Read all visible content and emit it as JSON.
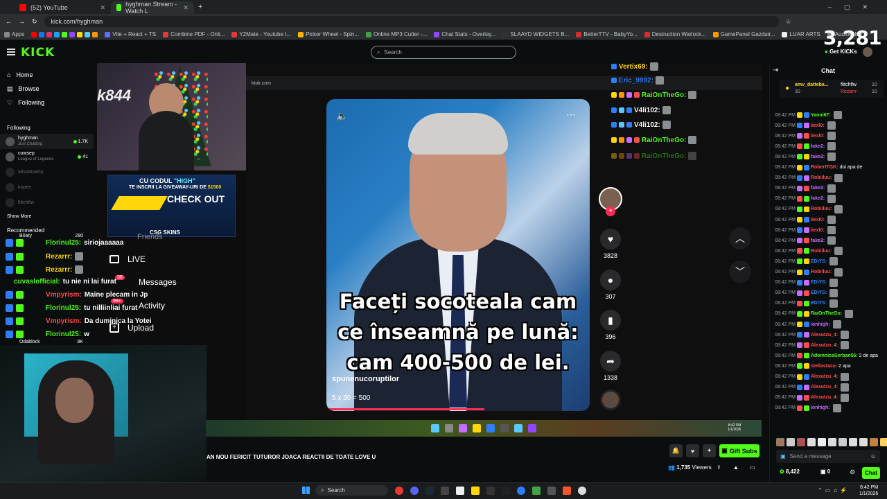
{
  "browser": {
    "tabs": [
      {
        "label": "(52) YouTube",
        "active": false,
        "color": "#ff0000"
      },
      {
        "label": "hyghman Stream - Watch L",
        "active": true,
        "color": "#53fc18"
      }
    ],
    "address": "kick.com/hyghman",
    "bookmarks": [
      "Apps",
      "Vite + React + TS",
      "Combine PDF - Onli...",
      "Y2Mate - Youtube t...",
      "Picker Wheel - Spin...",
      "Online MP3 Cutter -...",
      "Chat Stats - Overlay...",
      "SLAAYD WIDGETS B...",
      "BetterTTV - BabyYo...",
      "Destruction Warlock...",
      "GamePanel Gazduir...",
      "LUAR ARTS",
      "Audiocalter"
    ]
  },
  "kick": {
    "logo": "KICK",
    "search_placeholder": "Search",
    "kick_count": "3,281",
    "get_kicks": "Get KICKs",
    "accent": "#53fc18"
  },
  "sidebar": {
    "nav": [
      {
        "label": "Home",
        "icon": "home-icon"
      },
      {
        "label": "Browse",
        "icon": "browse-icon"
      },
      {
        "label": "Following",
        "icon": "heart-icon"
      }
    ],
    "following_title": "Following",
    "following": [
      {
        "name": "hyghman",
        "category": "Just Chatting",
        "viewers": "1.7K"
      },
      {
        "name": "cowsep",
        "category": "League of Legends",
        "viewers": "41"
      },
      {
        "name": "MissMoarta",
        "category": "",
        "viewers": ""
      },
      {
        "name": "kopee",
        "category": "",
        "viewers": ""
      },
      {
        "name": "flitchflw",
        "category": "",
        "viewers": ""
      }
    ],
    "show_more": "Show More",
    "recommended_title": "Recommended",
    "recommended_top": {
      "name": "B0aty",
      "viewers": "280"
    },
    "recommended_bottom": {
      "name": "Odablock",
      "viewers": "8K"
    }
  },
  "stream_overlay": {
    "webcam_text": "k844",
    "promo": {
      "line1_pre": "CU CODUL ",
      "line1_code": "\"HIGH\"",
      "line2_pre": "TE INSCRII LA GIVEAWAY-URI DE ",
      "line2_amount": "$1500",
      "line3": "CHECK OUT",
      "line4": "CSG SKINS"
    },
    "inner_url": "ktok.com",
    "video": {
      "caption": "Faceți socoteala cam ce înseamnă pe lună: cam 400-500 de lei.",
      "handle": "spunenucoruptilor",
      "calc": "5 x 30 = 500",
      "progress": 0.6
    },
    "actions": [
      {
        "icon": "heart-icon",
        "count": "3828"
      },
      {
        "icon": "comment-icon",
        "count": "307"
      },
      {
        "icon": "bookmark-icon",
        "count": "396"
      },
      {
        "icon": "share-icon",
        "count": "1338"
      }
    ],
    "tiktok_side": [
      {
        "label": "Friends",
        "icon": "friends-icon"
      },
      {
        "label": "LIVE",
        "icon": "live-icon"
      },
      {
        "label": "Messages",
        "icon": "messages-icon"
      },
      {
        "label": "Activity",
        "icon": "activity-icon"
      },
      {
        "label": "Upload",
        "icon": "upload-icon"
      }
    ],
    "badges": {
      "messages": "38",
      "activity": "99+"
    },
    "overlay_chat_left": [
      {
        "user": "Florinul25:",
        "msg": "siriojaaaaaa",
        "color": "#53fc18"
      },
      {
        "user": "Rezarrr:",
        "msg": "",
        "color": "#ffd60a"
      },
      {
        "user": "Rezarrr:",
        "msg": "",
        "color": "#ffd60a"
      },
      {
        "user": "cuvaslofficial:",
        "msg": "tu nie ni lai furat",
        "color": "#53fc18"
      },
      {
        "user": "Vmpyrism:",
        "msg": "Maine plecam in Jp",
        "color": "#ff4d4d"
      },
      {
        "user": "Florinul25:",
        "msg": "tu nilliinliai furat",
        "color": "#53fc18"
      },
      {
        "user": "Vmpyrism:",
        "msg": "Da duminica la Yotei",
        "color": "#ff4d4d"
      },
      {
        "user": "Florinul25:",
        "msg": "w",
        "color": "#53fc18"
      }
    ],
    "overlay_chat_right": [
      {
        "user": "Vertix69:",
        "color": "#ffd60a"
      },
      {
        "user": "Eric_9992:",
        "color": "#2d7ff9"
      },
      {
        "user": "RaiOnTheGo:",
        "color": "#53fc18"
      },
      {
        "user": "V4li102:",
        "color": "#ffffff"
      },
      {
        "user": "V4li102:",
        "color": "#ffffff"
      },
      {
        "user": "RaiOnTheGo:",
        "color": "#53fc18"
      },
      {
        "user": "RaiOnTheGo:",
        "color": "#53fc18"
      }
    ],
    "inner_clock": {
      "time": "8:42 PM",
      "date": "1/1/2026"
    }
  },
  "below_player": {
    "marquee": "AN NOU FERICIT TUTUROR JOACA REACTII DE TOATE LOVE U",
    "gift_subs": "Gift Subs",
    "viewers_count": "1,735",
    "viewers_label": "Viewers"
  },
  "chat": {
    "title": "Chat",
    "pinned": {
      "user": "amv_datteba...",
      "count": "30",
      "r1_user": "flitchflw",
      "r1_count": "10",
      "r2_user": "Rezarrr",
      "r2_count": "10"
    },
    "messages": [
      {
        "time": "08:42 PM",
        "user": "Yanni67:",
        "msg": "",
        "color": "#53fc18"
      },
      {
        "time": "08:42 PM",
        "user": "iiexl0:",
        "msg": "",
        "color": "#ff4d4d"
      },
      {
        "time": "08:42 PM",
        "user": "iiexl0:",
        "msg": "",
        "color": "#ff4d4d"
      },
      {
        "time": "08:42 PM",
        "user": "fake2:",
        "msg": "",
        "color": "#c86bff"
      },
      {
        "time": "08:42 PM",
        "user": "fake2:",
        "msg": "",
        "color": "#c86bff"
      },
      {
        "time": "08:42 PM",
        "user": "RobertTGK:",
        "msg": "doi apa de",
        "color": "#ff4d4d"
      },
      {
        "time": "08:42 PM",
        "user": "Robiiluu:",
        "msg": "",
        "color": "#ff4d4d"
      },
      {
        "time": "08:42 PM",
        "user": "fake2:",
        "msg": "",
        "color": "#c86bff"
      },
      {
        "time": "08:42 PM",
        "user": "fake2:",
        "msg": "",
        "color": "#c86bff"
      },
      {
        "time": "08:42 PM",
        "user": "Robiiluu:",
        "msg": "",
        "color": "#ff4d4d"
      },
      {
        "time": "08:42 PM",
        "user": "iiexl0:",
        "msg": "",
        "color": "#ff4d4d"
      },
      {
        "time": "08:42 PM",
        "user": "iiexl0:",
        "msg": "",
        "color": "#ff4d4d"
      },
      {
        "time": "08:42 PM",
        "user": "fake2:",
        "msg": "",
        "color": "#c86bff"
      },
      {
        "time": "08:42 PM",
        "user": "Robiiluu:",
        "msg": "",
        "color": "#ff4d4d"
      },
      {
        "time": "08:42 PM",
        "user": "EDiYS:",
        "msg": "",
        "color": "#2d7ff9"
      },
      {
        "time": "08:42 PM",
        "user": "Robiiluu:",
        "msg": "",
        "color": "#ff4d4d"
      },
      {
        "time": "08:42 PM",
        "user": "EDiYS:",
        "msg": "",
        "color": "#2d7ff9"
      },
      {
        "time": "08:42 PM",
        "user": "EDiYS:",
        "msg": "",
        "color": "#2d7ff9"
      },
      {
        "time": "08:42 PM",
        "user": "EDiYS:",
        "msg": "",
        "color": "#2d7ff9"
      },
      {
        "time": "08:42 PM",
        "user": "RaiOnTheGo:",
        "msg": "",
        "color": "#53fc18"
      },
      {
        "time": "08:42 PM",
        "user": "ionhigh:",
        "msg": "",
        "color": "#c86bff"
      },
      {
        "time": "08:42 PM",
        "user": "Alexutzu_4:",
        "msg": "",
        "color": "#ff4d4d"
      },
      {
        "time": "08:42 PM",
        "user": "Alexutzu_4:",
        "msg": "",
        "color": "#ff4d4d"
      },
      {
        "time": "08:42 PM",
        "user": "AdomnicaSerban56:",
        "msg": "2 de apa",
        "color": "#53fc18"
      },
      {
        "time": "08:42 PM",
        "user": "stellastaca:",
        "msg": "2 apa",
        "color": "#ff4d4d"
      },
      {
        "time": "08:42 PM",
        "user": "Alexutzu_4:",
        "msg": "",
        "color": "#ff4d4d"
      },
      {
        "time": "08:42 PM",
        "user": "Alexutzu_4:",
        "msg": "",
        "color": "#ff4d4d"
      },
      {
        "time": "08:42 PM",
        "user": "Alexutzu_4:",
        "msg": "",
        "color": "#ff4d4d"
      },
      {
        "time": "08:42 PM",
        "user": "ionhigh:",
        "msg": "",
        "color": "#c86bff"
      }
    ],
    "input_placeholder": "Send a message",
    "points": "8,422",
    "kicks": "0",
    "send_label": "Chat"
  },
  "os": {
    "search_label": "Search",
    "time": "8:42 PM",
    "date": "1/1/2026"
  }
}
